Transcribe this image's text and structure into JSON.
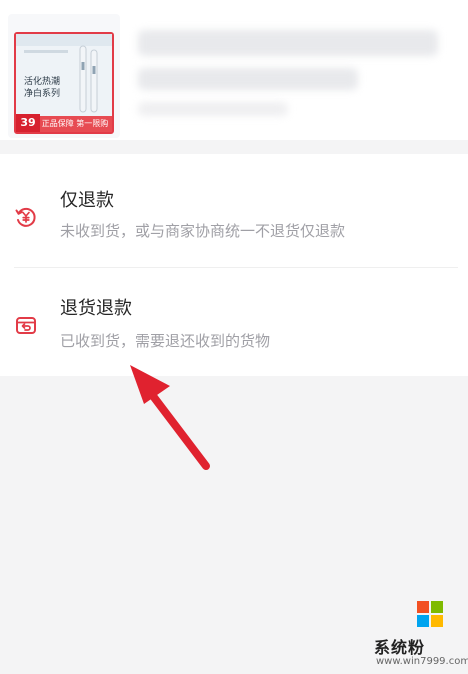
{
  "product": {
    "thumb_text": "活化热潮 净白系列",
    "promo_strip": "正品保障 第一限购",
    "price": "39"
  },
  "refund_options": [
    {
      "title": "仅退款",
      "desc": "未收到货，或与商家协商统一不退货仅退款",
      "icon": "refund-money-icon"
    },
    {
      "title": "退货退款",
      "desc": "已收到货，需要退还收到的货物",
      "icon": "return-package-icon"
    }
  ],
  "watermark": {
    "title": "系统粉",
    "url": "www.win7999.com"
  },
  "colors": {
    "accent_red": "#e23b47",
    "arrow_red": "#e0222f"
  }
}
